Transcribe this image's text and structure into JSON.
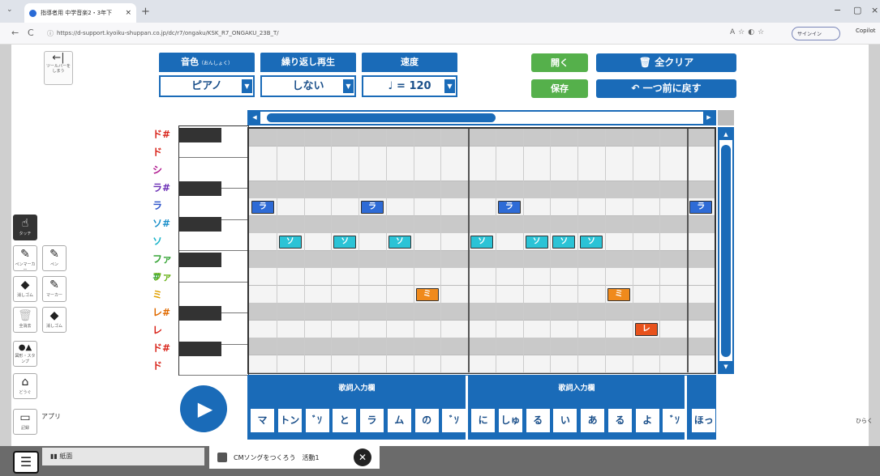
{
  "browser": {
    "tab_title": "指導者用 中学音楽2・3年下",
    "tab_close": "×",
    "new_tab": "+",
    "tab_menu": "⌄",
    "url": "https://d-support.kyoiku-shuppan.co.jp/dc/r7/ongaku/KSK_R7_ONGAKU_23B_T/",
    "nav_back": "←",
    "nav_reload": "C",
    "signin": "サインイン",
    "copilot": "Copilot",
    "min": "−",
    "max": "▢",
    "close": "×"
  },
  "toolbar": {
    "hide_label": "ツールバーをしまう",
    "hide_arrow": "←|",
    "tools": [
      {
        "label": "タッチ",
        "icon": "hand-icon",
        "glyph": "☝",
        "active": true
      },
      {
        "label": "ペンマーカー",
        "icon": "pen-marker-icon",
        "glyph": "✎"
      },
      {
        "label": "ペン",
        "icon": "pen-icon",
        "glyph": "✎"
      },
      {
        "label": "消しゴム",
        "icon": "eraser-icon",
        "glyph": "◆"
      },
      {
        "label": "マーカー",
        "icon": "marker-icon",
        "glyph": "✎"
      },
      {
        "label": "全消去",
        "icon": "trash-icon",
        "glyph": "🗑",
        "disabled": true
      },
      {
        "label": "消しゴム",
        "icon": "eraser-icon-2",
        "glyph": "◆"
      },
      {
        "label": "図形・スタンプ",
        "icon": "shapes-icon",
        "glyph": "●▲"
      },
      {
        "label": "どうぐ",
        "icon": "tools-icon",
        "glyph": "⌂"
      },
      {
        "label": "記録",
        "icon": "record-icon",
        "glyph": "▭"
      }
    ],
    "app_label": "アプリ"
  },
  "controls": {
    "timbre_label": "音色",
    "timbre_reading": "（おんしょく）",
    "timbre_value": "ピアノ",
    "repeat_label": "繰り返し再生",
    "repeat_value": "しない",
    "tempo_label": "速度",
    "tempo_value": "♩ = 120",
    "dropdown_glyph": "▼",
    "open_label": "開く",
    "save_label": "保存",
    "clear_label": "全クリア",
    "undo_label": "一つ前に戻す"
  },
  "note_names": [
    {
      "label": "ド#",
      "color": "#d9261c"
    },
    {
      "label": "ド",
      "color": "#d9261c"
    },
    {
      "label": "シ",
      "color": "#b0198f"
    },
    {
      "label": "ラ#",
      "color": "#6b2fb5"
    },
    {
      "label": "ラ",
      "color": "#2a52c9"
    },
    {
      "label": "ソ#",
      "color": "#1a8fc9"
    },
    {
      "label": "ソ",
      "color": "#19b3c9"
    },
    {
      "label": "ファ#",
      "color": "#3aa63a"
    },
    {
      "label": "ファ",
      "color": "#6bb31c"
    },
    {
      "label": "ミ",
      "color": "#e0a000"
    },
    {
      "label": "レ#",
      "color": "#e06a00"
    },
    {
      "label": "レ",
      "color": "#d9261c"
    },
    {
      "label": "ド#",
      "color": "#d9261c"
    },
    {
      "label": "ド",
      "color": "#d9261c"
    }
  ],
  "notes": [
    {
      "row": 4,
      "col": 0,
      "label": "ラ",
      "color": "#2e6bd6"
    },
    {
      "row": 6,
      "col": 1,
      "label": "ソ",
      "color": "#2bc3d6"
    },
    {
      "row": 6,
      "col": 3,
      "label": "ソ",
      "color": "#2bc3d6"
    },
    {
      "row": 4,
      "col": 4,
      "label": "ラ",
      "color": "#2e6bd6"
    },
    {
      "row": 6,
      "col": 5,
      "label": "ソ",
      "color": "#2bc3d6"
    },
    {
      "row": 9,
      "col": 6,
      "label": "ミ",
      "color": "#f08a1c"
    },
    {
      "row": 6,
      "col": 8,
      "label": "ソ",
      "color": "#2bc3d6"
    },
    {
      "row": 4,
      "col": 9,
      "label": "ラ",
      "color": "#2e6bd6"
    },
    {
      "row": 6,
      "col": 10,
      "label": "ソ",
      "color": "#2bc3d6"
    },
    {
      "row": 6,
      "col": 11,
      "label": "ソ",
      "color": "#2bc3d6"
    },
    {
      "row": 6,
      "col": 12,
      "label": "ソ",
      "color": "#2bc3d6"
    },
    {
      "row": 9,
      "col": 13,
      "label": "ミ",
      "color": "#f08a1c"
    },
    {
      "row": 11,
      "col": 14,
      "label": "レ",
      "color": "#e8521c"
    },
    {
      "row": 4,
      "col": 16,
      "label": "ラ",
      "color": "#2e6bd6"
    }
  ],
  "lyrics": {
    "header": "歌詞入力欄",
    "cells": [
      "マ",
      "トン",
      "ﾞｿ",
      "と",
      "ラ",
      "ム",
      "の",
      "ﾞｿ",
      "に",
      "しゅ",
      "る",
      "い",
      "あ",
      "る",
      "よ",
      "ﾞｿ",
      "ほっ"
    ]
  },
  "play_glyph": "▶",
  "right_label": "ひらく",
  "bottom": {
    "tab1_label": "紙面",
    "tab2_label": "CMソングをつくろう　活動1",
    "close_glyph": "✕",
    "menu_glyph": "☰"
  },
  "colors": {
    "accent": "#1a6bb8",
    "green": "#55b04b",
    "row_grey": "#c9c9c9",
    "row_light": "#f4f4f4"
  }
}
